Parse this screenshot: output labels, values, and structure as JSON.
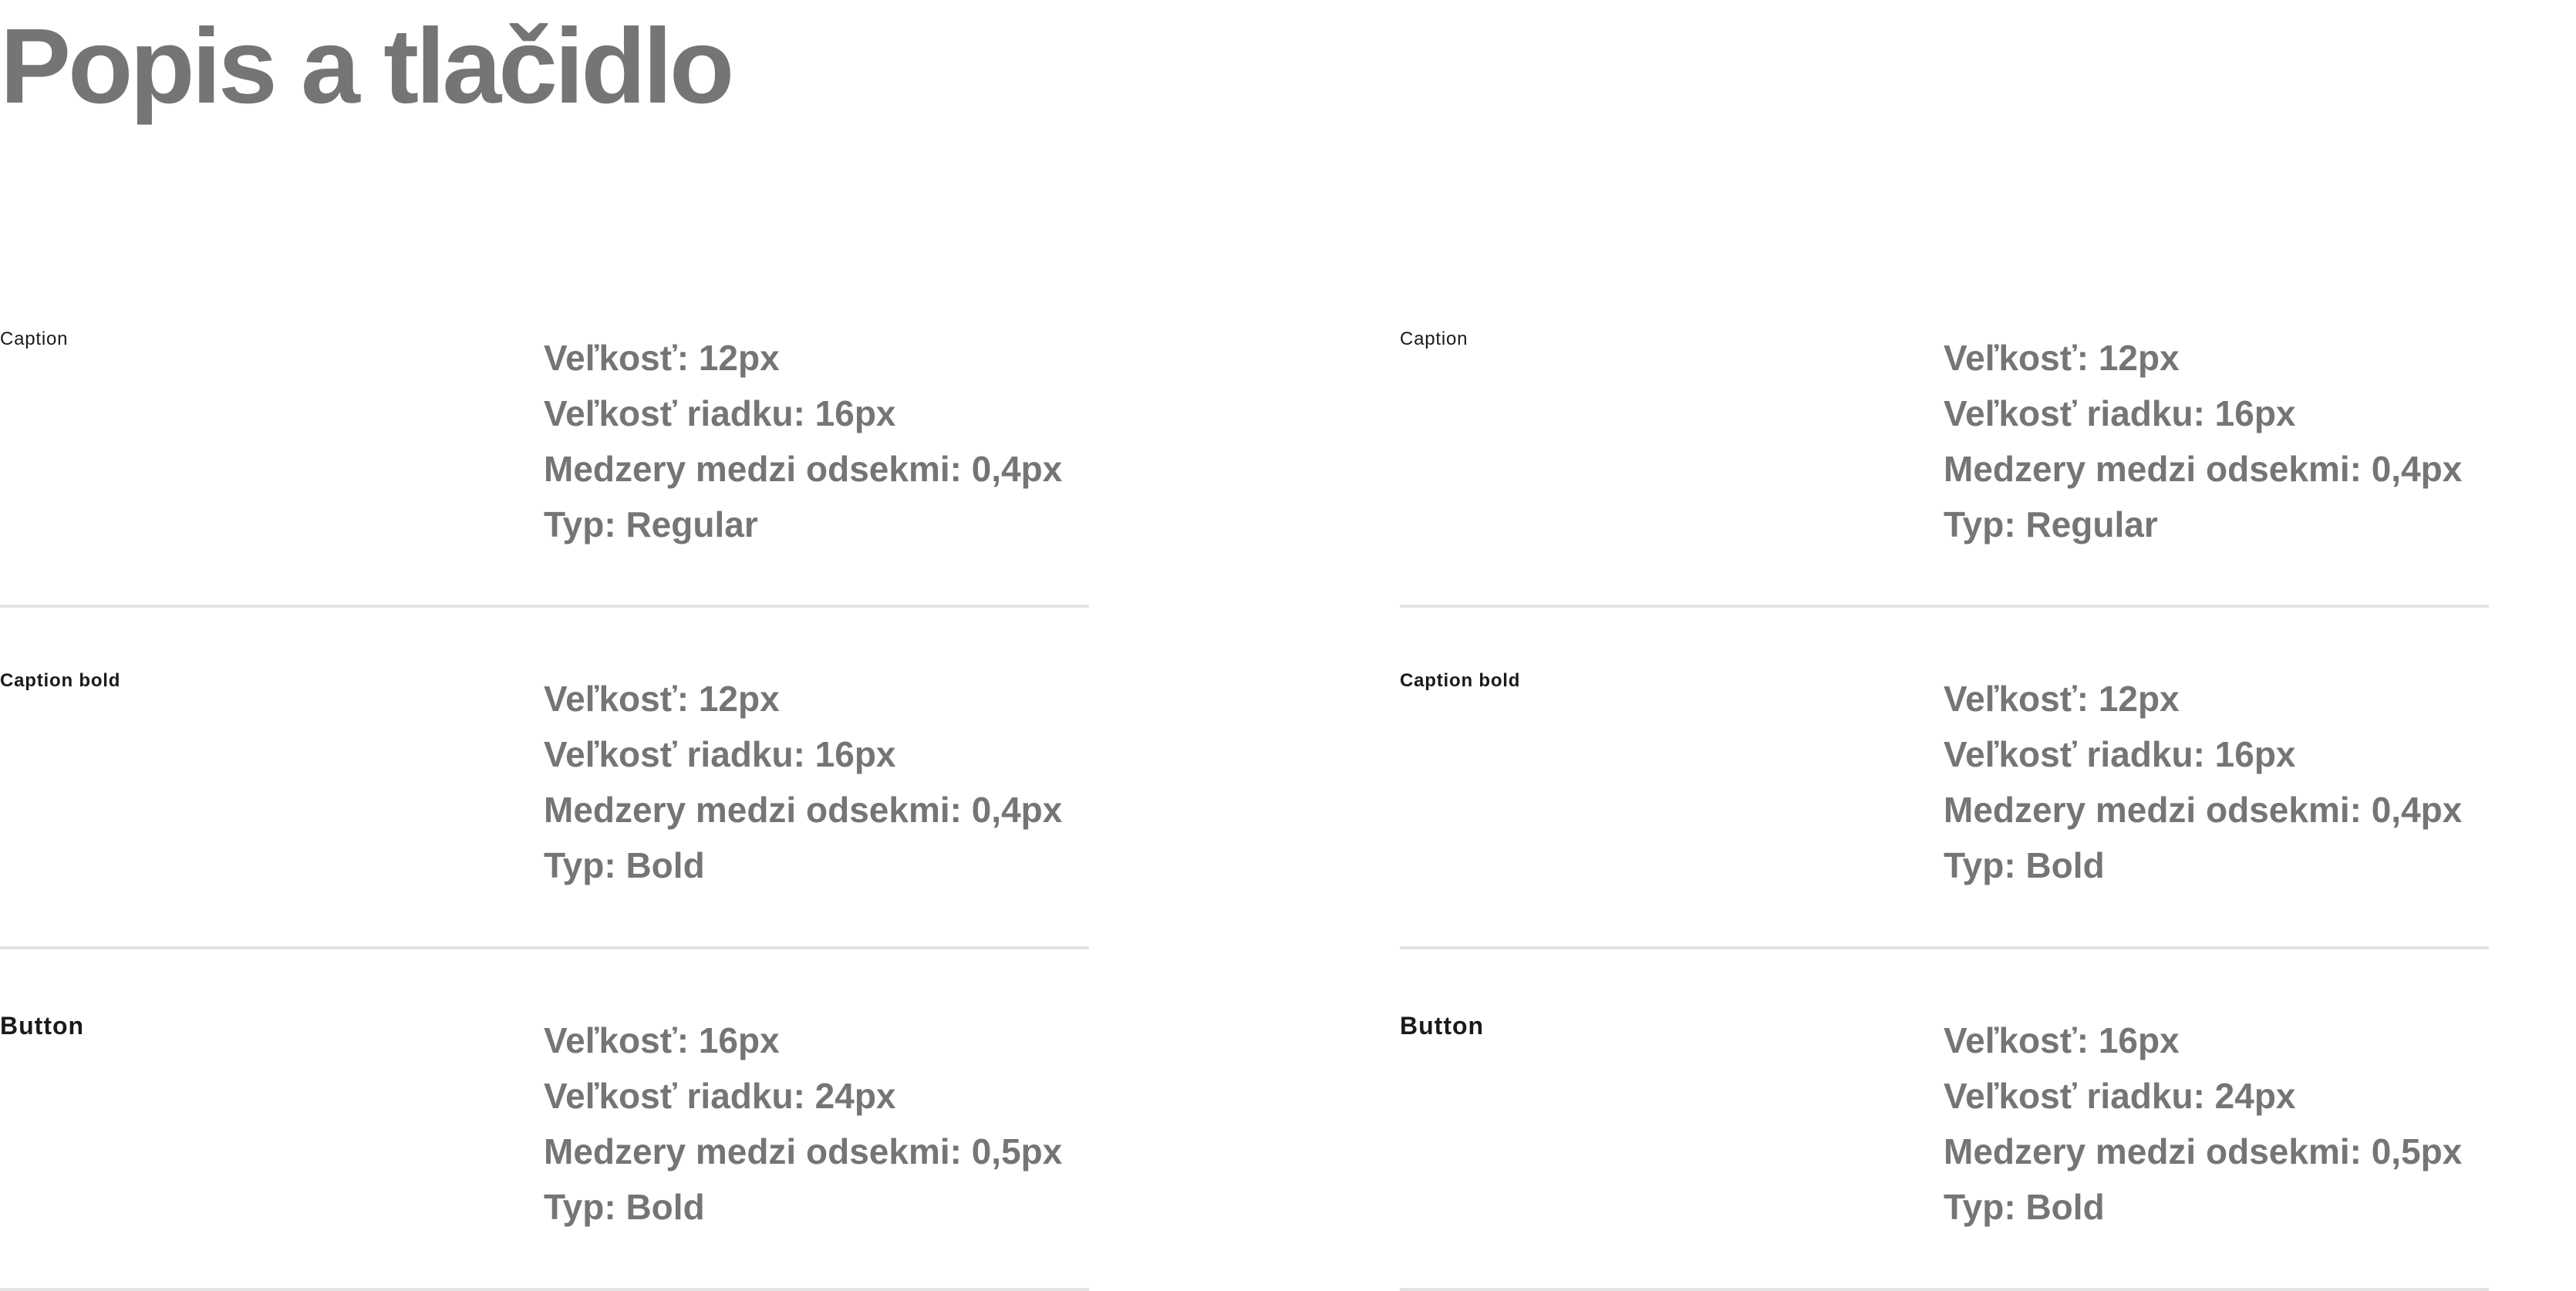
{
  "title": "Popis a tlačidlo",
  "columns": [
    {
      "rows": [
        {
          "name": "Caption",
          "specs": [
            "Veľkosť: 12px",
            "Veľkosť riadku: 16px",
            "Medzery medzi odsekmi: 0,4px",
            "Typ: Regular"
          ]
        },
        {
          "name": "Caption bold",
          "specs": [
            "Veľkosť: 12px",
            "Veľkosť riadku: 16px",
            "Medzery medzi odsekmi: 0,4px",
            "Typ: Bold"
          ]
        },
        {
          "name": "Button",
          "specs": [
            "Veľkosť: 16px",
            "Veľkosť riadku: 24px",
            "Medzery medzi odsekmi: 0,5px",
            "Typ: Bold"
          ]
        }
      ]
    },
    {
      "rows": [
        {
          "name": "Caption",
          "specs": [
            "Veľkosť: 12px",
            "Veľkosť riadku: 16px",
            "Medzery medzi odsekmi: 0,4px",
            "Typ: Regular"
          ]
        },
        {
          "name": "Caption bold",
          "specs": [
            "Veľkosť: 12px",
            "Veľkosť riadku: 16px",
            "Medzery medzi odsekmi: 0,4px",
            "Typ: Bold"
          ]
        },
        {
          "name": "Button",
          "specs": [
            "Veľkosť: 16px",
            "Veľkosť riadku: 24px",
            "Medzery medzi odsekmi: 0,5px",
            "Typ: Bold"
          ]
        }
      ]
    }
  ],
  "colors": {
    "title": "#757575",
    "spec_text": "#757575",
    "style_name": "#1a1a1a",
    "divider": "#e3e3e3",
    "background": "#ffffff"
  }
}
